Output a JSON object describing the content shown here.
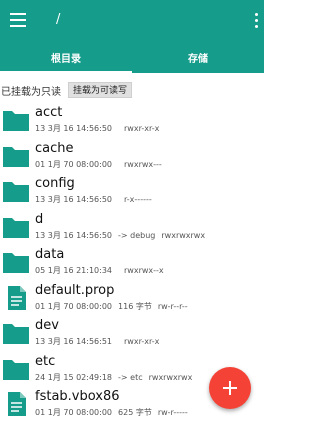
{
  "header": {
    "path": "/"
  },
  "tabs": [
    {
      "label": "根目录"
    },
    {
      "label": "存储"
    }
  ],
  "mount": {
    "status": "已挂载为只读",
    "button": "挂载为可读写"
  },
  "files": [
    {
      "name": "acct",
      "type": "folder",
      "date": "13 3月 16 14:56:50",
      "link": "",
      "perm": "rwxr-xr-x"
    },
    {
      "name": "cache",
      "type": "folder",
      "date": "01 1月 70 08:00:00",
      "link": "",
      "perm": "rwxrwx---"
    },
    {
      "name": "config",
      "type": "folder",
      "date": "13 3月 16 14:56:50",
      "link": "",
      "perm": "r-x------"
    },
    {
      "name": "d",
      "type": "folder",
      "date": "13 3月 16 14:56:50",
      "link": "-> debug",
      "perm": "rwxrwxrwx"
    },
    {
      "name": "data",
      "type": "folder",
      "date": "05 1月 16 21:10:34",
      "link": "",
      "perm": "rwxrwx--x"
    },
    {
      "name": "default.prop",
      "type": "file",
      "date": "01 1月 70 08:00:00",
      "link": "116 字节",
      "perm": "rw-r--r--"
    },
    {
      "name": "dev",
      "type": "folder",
      "date": "13 3月 16 14:56:51",
      "link": "",
      "perm": "rwxr-xr-x"
    },
    {
      "name": "etc",
      "type": "folder",
      "date": "24 1月 15 02:49:18",
      "link": "-> etc",
      "perm": "rwxrwxrwx"
    },
    {
      "name": "fstab.vbox86",
      "type": "file",
      "date": "01 1月 70 08:00:00",
      "link": "625 字节",
      "perm": "rw-r-----"
    }
  ],
  "colors": {
    "appbar": "#159c8b",
    "folder": "#159c8b",
    "fab": "#f44336"
  },
  "icons": {
    "menu": "hamburger-menu-icon",
    "overflow": "more-vert-icon",
    "fab": "plus-icon",
    "folder": "folder-icon",
    "file": "document-icon"
  }
}
